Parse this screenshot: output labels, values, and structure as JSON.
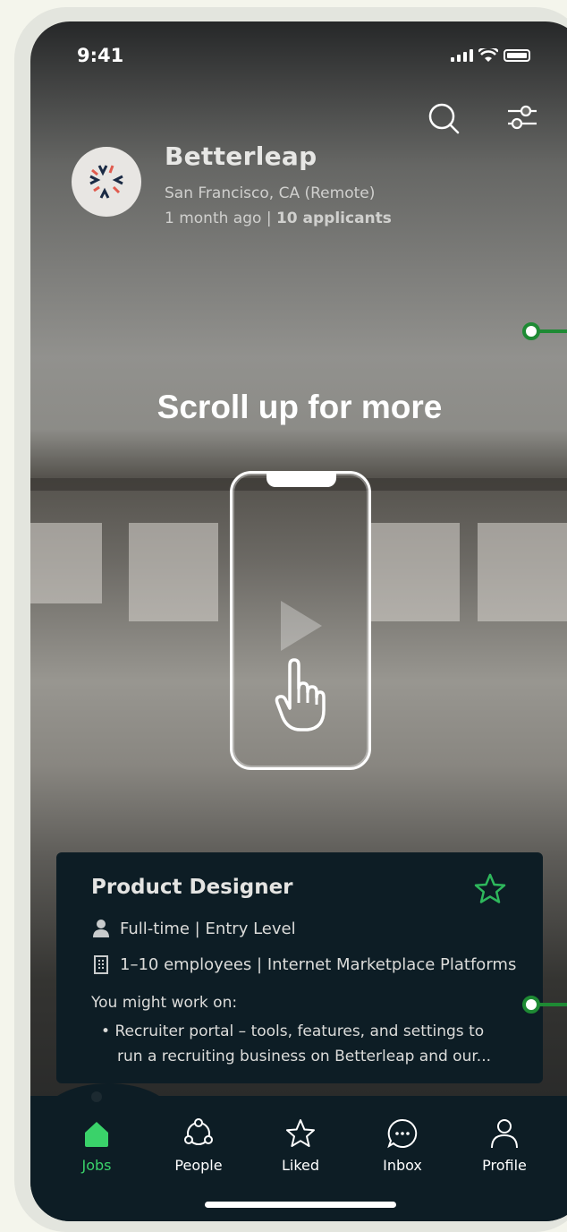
{
  "status_bar": {
    "time": "9:41"
  },
  "company": {
    "name": "Betterleap",
    "location": "San Francisco, CA (Remote)",
    "posted": "1 month ago",
    "separator": "|",
    "applicants": "10 applicants"
  },
  "overlay": {
    "hint": "Scroll up for more"
  },
  "job": {
    "title": "Product Designer",
    "type": "Full-time | Entry Level",
    "company_info": "1–10 employees | Internet Marketplace Platforms",
    "work_heading": "You might work on:",
    "work_bullet_line1": "Recruiter portal – tools, features, and settings to",
    "work_bullet_line2": "run a recruiting business on Betterleap and our..."
  },
  "nav": {
    "items": [
      {
        "label": "Jobs",
        "icon": "home-icon",
        "active": true
      },
      {
        "label": "People",
        "icon": "people-icon"
      },
      {
        "label": "Liked",
        "icon": "star-icon"
      },
      {
        "label": "Inbox",
        "icon": "chat-icon"
      },
      {
        "label": "Profile",
        "icon": "profile-icon"
      }
    ]
  },
  "colors": {
    "accent": "#3ad26a",
    "card": "#0d1d25",
    "slider": "#1e8a34"
  }
}
